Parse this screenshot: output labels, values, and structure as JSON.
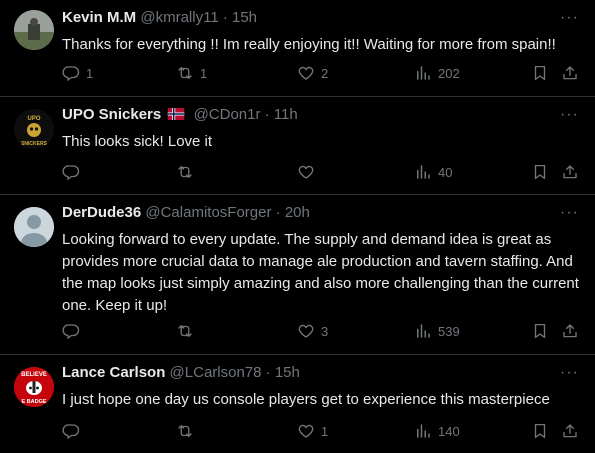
{
  "tweets": [
    {
      "name": "Kevin M.M",
      "handle": "@kmrally11",
      "sep": "·",
      "time": "15h",
      "text": "Thanks for everything !! Im really enjoying it!! Waiting for more from spain!!",
      "replies": "1",
      "retweets": "1",
      "likes": "2",
      "views": "202"
    },
    {
      "name": "UPO Snickers",
      "flag": "norway-flag",
      "handle": "@CDon1r",
      "sep": "·",
      "time": "11h",
      "text": "This looks sick! Love it",
      "replies": "",
      "retweets": "",
      "likes": "",
      "views": "40",
      "avatar_text": [
        "UPO",
        "SNICKERS"
      ]
    },
    {
      "name": "DerDude36",
      "handle": "@CalamitosForger",
      "sep": "·",
      "time": "20h",
      "text": "Looking forward to every update. The supply and demand idea is great as provides more crucial data to manage ale production and tavern staffing. And the map looks just simply amazing and also more challenging than the current one. Keep it up!",
      "replies": "",
      "retweets": "",
      "likes": "3",
      "views": "539"
    },
    {
      "name": "Lance Carlson",
      "handle": "@LCarlson78",
      "sep": "·",
      "time": "15h",
      "text": "I just hope one day us console players get to experience this masterpiece",
      "replies": "",
      "retweets": "",
      "likes": "1",
      "views": "140",
      "avatar_text": [
        "BELIEVE",
        "E BADGE"
      ]
    }
  ],
  "more_label": "···",
  "colors": {
    "background": "#000000",
    "text": "#e7e9ea",
    "muted": "#71767b",
    "divider": "#2f3336"
  },
  "icons": [
    "reply-icon",
    "retweet-icon",
    "like-icon",
    "views-icon",
    "bookmark-icon",
    "share-icon",
    "more-icon"
  ]
}
